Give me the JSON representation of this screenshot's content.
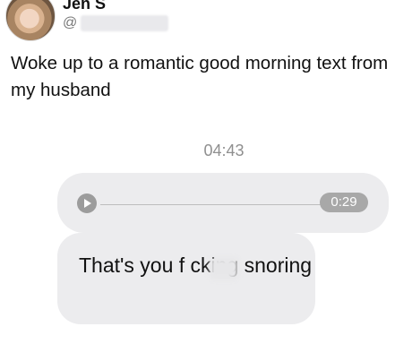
{
  "post": {
    "author_name": "Jen S",
    "handle": "@",
    "text": "Woke up to a romantic good morning text from my husband"
  },
  "chat": {
    "timestamp": "04:43",
    "voice_message": {
      "duration": "0:29",
      "play_icon": "play-icon"
    },
    "message_text": "That's you f  cking snoring"
  },
  "colors": {
    "bubble": "#ececee",
    "badge": "#a8a8a8",
    "timestamp": "#8f8f8f"
  }
}
